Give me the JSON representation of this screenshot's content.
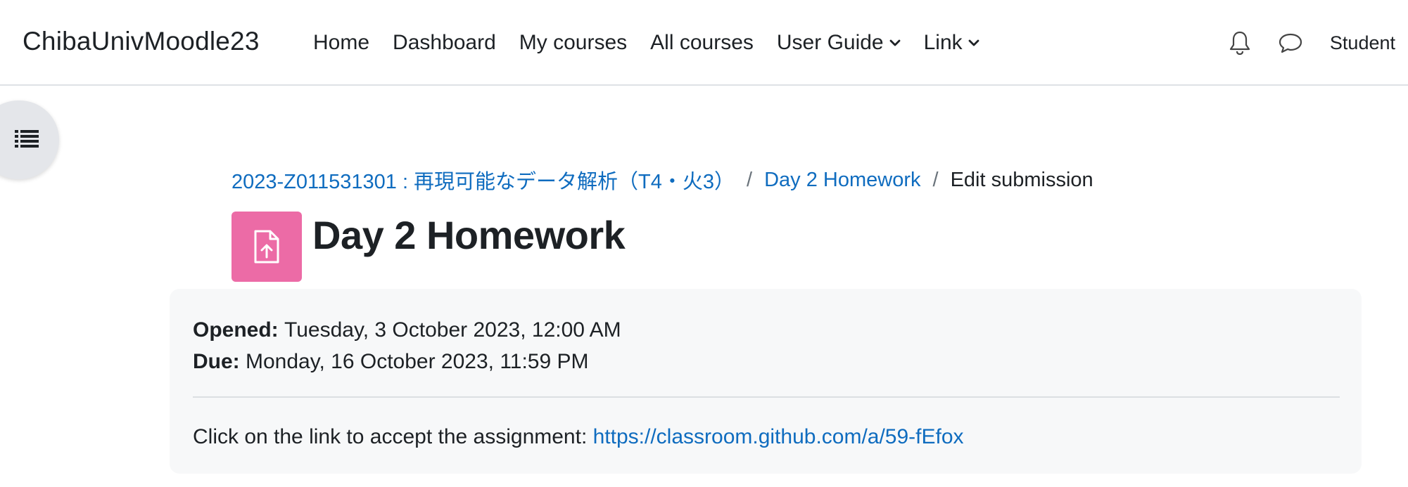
{
  "navbar": {
    "brand": "ChibaUnivMoodle23",
    "links": [
      {
        "label": "Home"
      },
      {
        "label": "Dashboard"
      },
      {
        "label": "My courses"
      },
      {
        "label": "All courses"
      },
      {
        "label": "User Guide",
        "has_dropdown": true
      },
      {
        "label": "Link",
        "has_dropdown": true
      }
    ],
    "icons": [
      "bell-icon",
      "chat-icon"
    ],
    "user_label": "Student"
  },
  "drawer": {
    "icon": "list-icon"
  },
  "breadcrumb": {
    "course": "2023-Z011531301 : 再現可能なデータ解析（T4・火3）",
    "separator": "/",
    "activity": "Day 2 Homework",
    "current": "Edit submission"
  },
  "page": {
    "title": "Day 2 Homework",
    "icon": "assignment-upload-icon",
    "icon_color": "#ec6ba6"
  },
  "dates": {
    "opened_label": "Opened:",
    "opened_value": "Tuesday, 3 October 2023, 12:00 AM",
    "due_label": "Due:",
    "due_value": "Monday, 16 October 2023, 11:59 PM"
  },
  "description": {
    "text": "Click on the link to accept the assignment: ",
    "link": "https://classroom.github.com/a/59-fEfox"
  },
  "colors": {
    "link": "#0f6cbf",
    "text": "#1d2125",
    "info_bg": "#f7f8f9"
  }
}
